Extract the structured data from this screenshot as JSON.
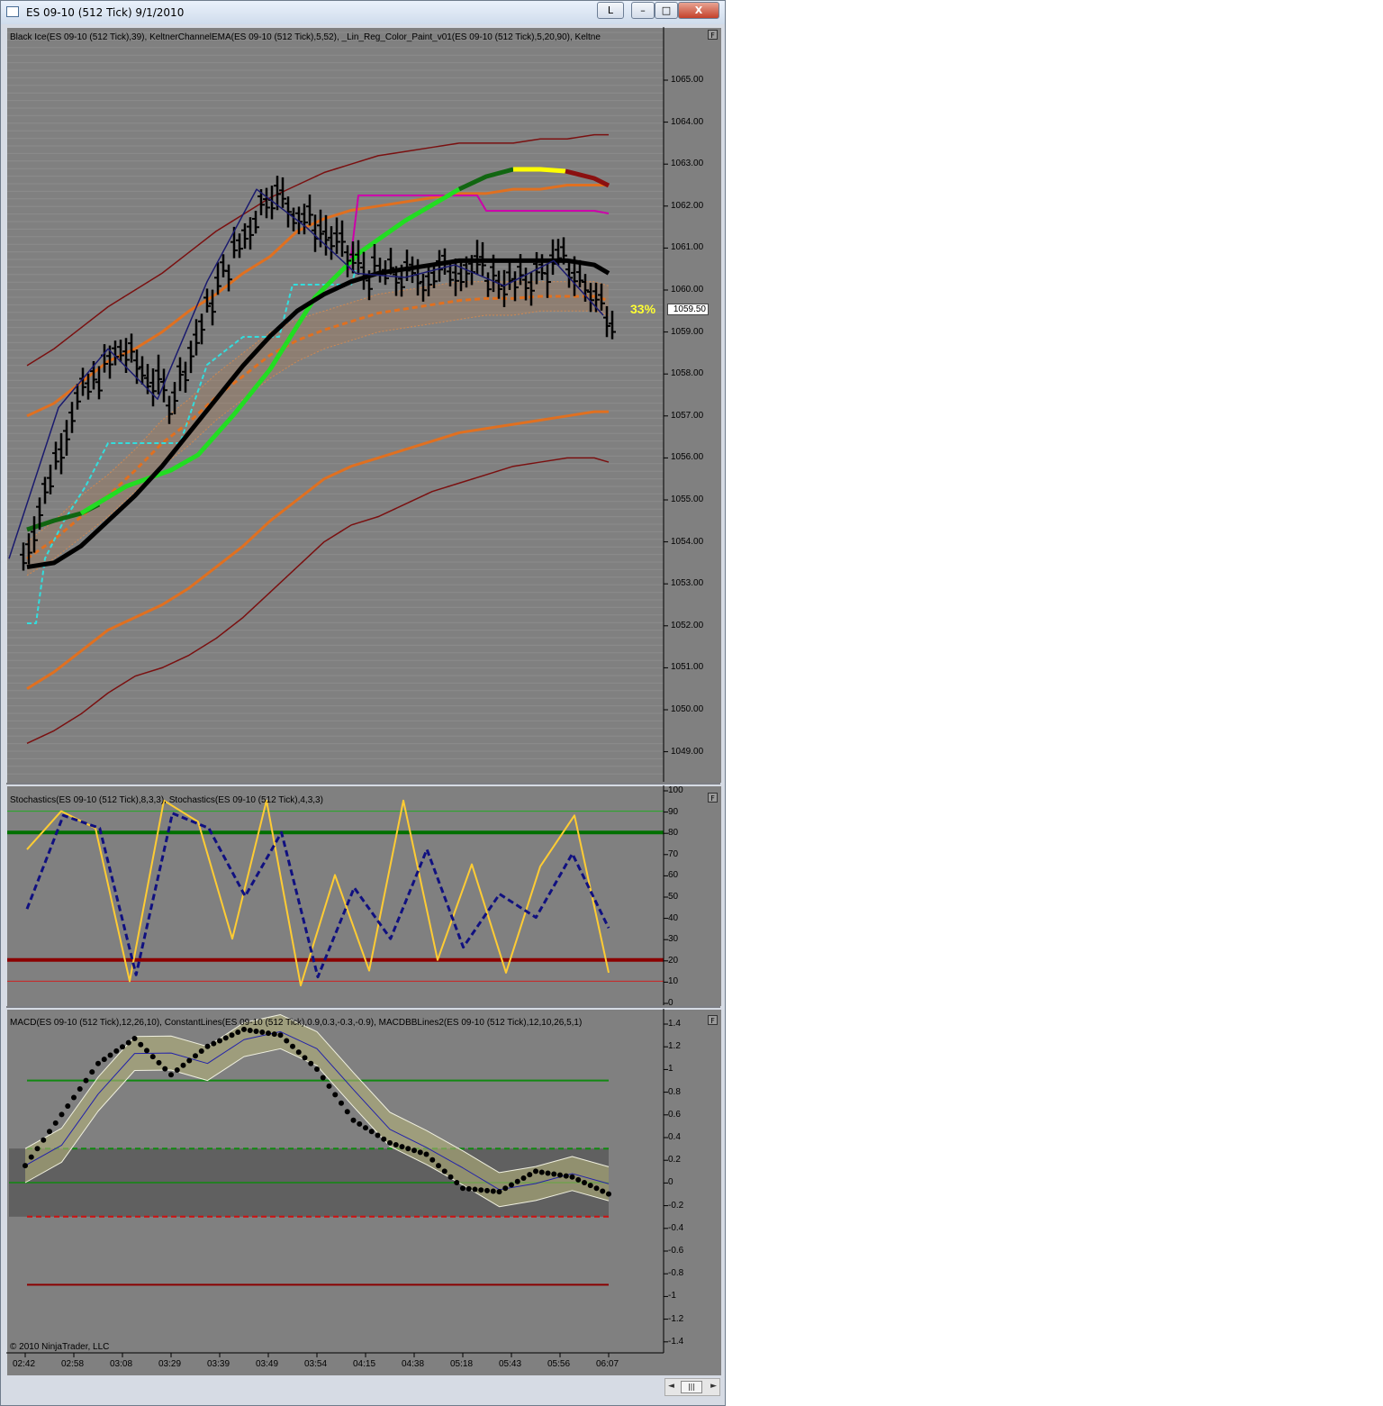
{
  "window": {
    "title": "ES 09-10 (512 Tick)  9/1/2010",
    "buttons": {
      "l": "L",
      "minimize": "–",
      "maximize": "□",
      "close": "X"
    }
  },
  "price_panel": {
    "indicator_title": "Black Ice(ES 09-10 (512 Tick),39), KeltnerChannelEMA(ES 09-10 (512 Tick),5,52), _Lin_Reg_Color_Paint_v01(ES 09-10 (512 Tick),5,20,90), Keltne",
    "y_ticks": [
      "1065.00",
      "1064.00",
      "1063.00",
      "1062.00",
      "1061.00",
      "1060.00",
      "1059.00",
      "1058.00",
      "1057.00",
      "1056.00",
      "1055.00",
      "1054.00",
      "1053.00",
      "1052.00",
      "1051.00",
      "1050.00",
      "1049.00"
    ],
    "last_price": "1059.50",
    "percent_label": "33%",
    "f_button": "F"
  },
  "stoch_panel": {
    "indicator_title": "Stochastics(ES 09-10 (512 Tick),8,3,3), Stochastics(ES 09-10 (512 Tick),4,3,3)",
    "y_ticks": [
      "100",
      "90",
      "80",
      "70",
      "60",
      "50",
      "40",
      "30",
      "20",
      "10",
      "0"
    ],
    "f_button": "F"
  },
  "macd_panel": {
    "indicator_title": "MACD(ES 09-10 (512 Tick),12,26,10), ConstantLines(ES 09-10 (512 Tick),0.9,0.3,-0.3,-0.9), MACDBBLines2(ES 09-10 (512 Tick),12,10,26,5,1)",
    "y_ticks": [
      "1.4",
      "1.2",
      "1",
      "0.8",
      "0.6",
      "0.4",
      "0.2",
      "0",
      "-0.2",
      "-0.4",
      "-0.6",
      "-0.8",
      "-1",
      "-1.2",
      "-1.4"
    ],
    "f_button": "F"
  },
  "x_axis": {
    "ticks": [
      "02:42",
      "02:58",
      "03:08",
      "03:29",
      "03:39",
      "03:49",
      "03:54",
      "04:15",
      "04:38",
      "05:18",
      "05:43",
      "05:56",
      "06:07"
    ]
  },
  "copyright": "© 2010 NinjaTrader, LLC",
  "scrollbar": {
    "left_arrow": "◄",
    "right_arrow": "►",
    "thumb": "|||"
  },
  "colors": {
    "panel_bg": "#808080",
    "price_bar": "#000000",
    "ema_orange": "#e07020",
    "keltner_darkred": "#7a1010",
    "linreg_green": "#22dd22",
    "linreg_yellow": "#ffff00",
    "trail_cyan": "#33dddd",
    "magenta": "#cc00aa",
    "stoch_fast": "#ffcc33",
    "stoch_slow": "#101080",
    "level_green": "#007000",
    "level_red": "#8b0000"
  },
  "chart_data": [
    {
      "type": "line",
      "title": "",
      "x": [
        "02:42",
        "02:58",
        "03:08",
        "03:29",
        "03:39",
        "03:49",
        "03:54",
        "04:15",
        "04:38",
        "05:18",
        "05:43",
        "05:56",
        "06:07"
      ],
      "ylim": [
        1048.5,
        1065.5
      ],
      "series": [
        {
          "values": [
            1053.6,
            1057.2,
            1058.6,
            1057.4,
            1060.2,
            1062.4,
            1061.5,
            1060.4,
            1060.3,
            1060.6,
            1060.1,
            1060.7,
            1059.4
          ]
        }
      ]
    },
    {
      "type": "line",
      "title": "",
      "ylim": [
        0,
        100
      ],
      "series": [
        {
          "values": [
            72,
            90,
            82,
            10,
            95,
            85,
            30,
            95,
            8,
            60,
            15,
            95,
            20,
            65,
            14,
            64,
            88,
            14
          ]
        },
        {
          "values": [
            44,
            88,
            82,
            13,
            89,
            82,
            50,
            80,
            12,
            54,
            30,
            72,
            26,
            51,
            40,
            70,
            35
          ]
        }
      ]
    },
    {
      "type": "line",
      "title": "",
      "ylim": [
        -1.4,
        1.4
      ],
      "series": [
        {
          "values": [
            0.15,
            0.6,
            1.05,
            1.27,
            0.95,
            1.2,
            1.35,
            1.3,
            1.0,
            0.55,
            0.35,
            0.25,
            -0.05,
            -0.08,
            0.1,
            0.05,
            -0.1
          ]
        }
      ]
    }
  ]
}
